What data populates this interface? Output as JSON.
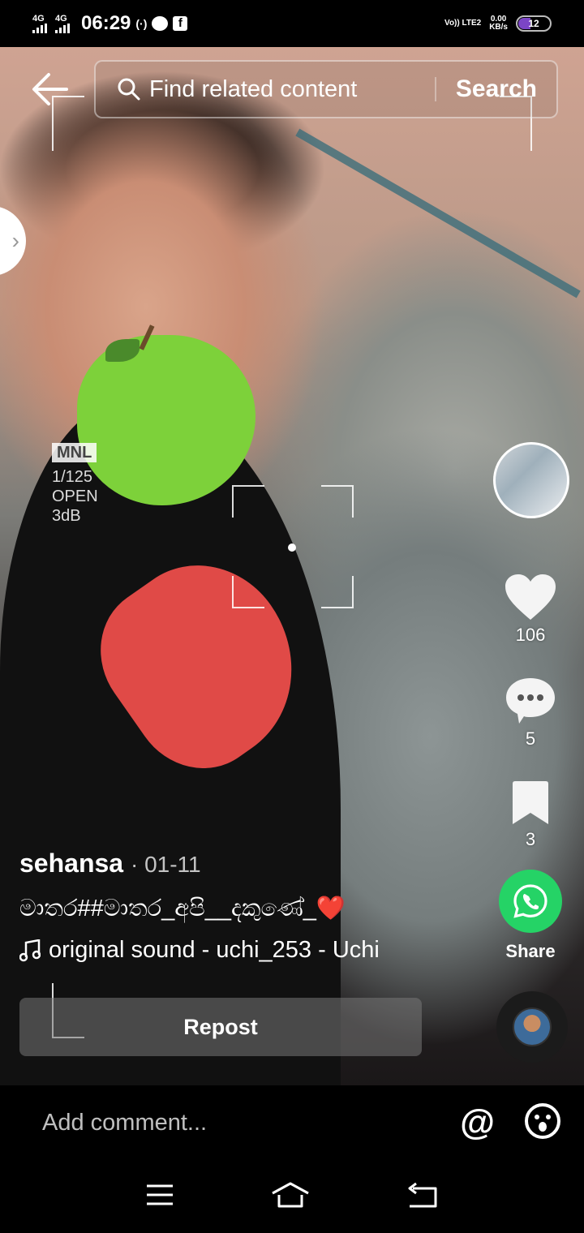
{
  "status_bar": {
    "sim1": "4G",
    "sim2": "4G",
    "time": "06:29",
    "hotspot": "(·)",
    "volte": "Vo)) LTE2",
    "speed_value": "0.00",
    "speed_unit": "KB/s",
    "battery": "12"
  },
  "camera_overlay": {
    "mode": "MNL",
    "shutter": "1/125",
    "aperture": "OPEN",
    "gain": "3dB"
  },
  "search": {
    "placeholder": "Find related content",
    "button": "Search"
  },
  "actions": {
    "likes": "106",
    "comments": "5",
    "saves": "3",
    "share_label": "Share"
  },
  "post": {
    "username": "sehansa",
    "date": "· 01-11",
    "description": "මාතර#​#මාතර_අපි__දකුණේ_",
    "description_emoji": "❤️",
    "sound": "original sound - uchi_253 - Uchi"
  },
  "repost_label": "Repost",
  "comment": {
    "placeholder": "Add comment..."
  }
}
